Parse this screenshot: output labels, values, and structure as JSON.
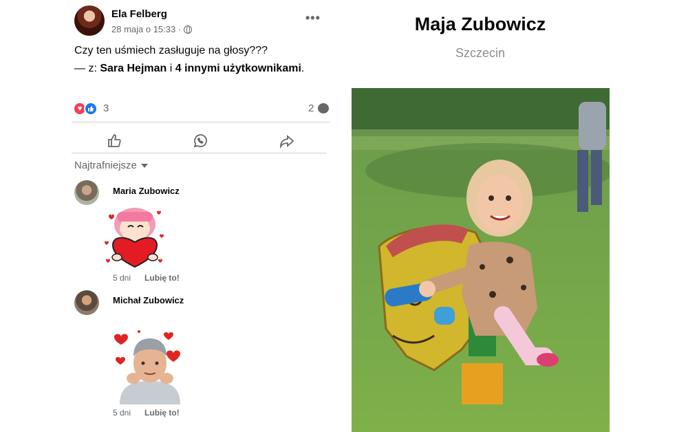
{
  "post": {
    "author": "Ela Felberg",
    "time": "28 maja o 15:33 ·",
    "more_label": "•••",
    "text": "Czy ten uśmiech zasługuje na głosy???",
    "tagged_prefix": "— z: ",
    "tagged_person": "Sara Hejman",
    "tagged_conj": " i ",
    "tagged_others": "4 innymi użytkownikami",
    "tagged_end": ".",
    "reaction_count": "3",
    "comment_count": "2"
  },
  "sort": {
    "label": "Najtrafniejsze"
  },
  "comments": [
    {
      "name": "Maria Zubowicz",
      "time": "5 dni",
      "like": "Lubię to!",
      "sticker": "girl-holding-heart-sticker"
    },
    {
      "name": "Michał Zubowicz",
      "time": "5 dni",
      "like": "Lubię to!",
      "sticker": "man-with-hearts-sticker"
    }
  ],
  "profile": {
    "name": "Maja Zubowicz",
    "city": "Szczecin"
  },
  "icons": [
    "globe-icon",
    "more-icon",
    "heart-reaction-icon",
    "like-reaction-icon",
    "comment-bubble-icon",
    "like-icon",
    "whatsapp-icon",
    "share-icon",
    "caret-down-icon"
  ],
  "colors": {
    "like_blue": "#1877f2",
    "heart_red": "#f33e58",
    "muted": "#65676b"
  }
}
